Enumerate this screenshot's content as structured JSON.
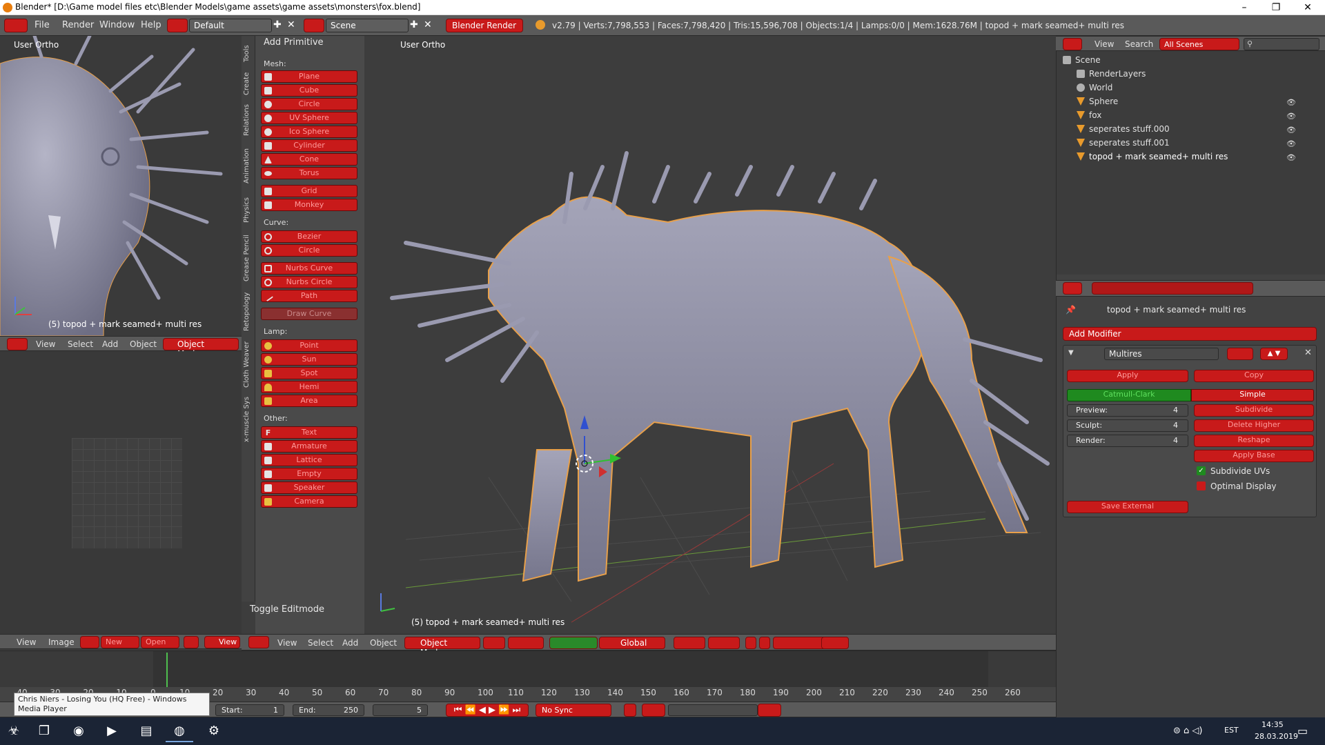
{
  "window": {
    "title": "Blender* [D:\\Game model files etc\\Blender Models\\game assets\\game assets\\monsters\\fox.blend]",
    "minimize": "–",
    "maximize": "❐",
    "close": "✕"
  },
  "menu": {
    "items": [
      "File",
      "Render",
      "Window",
      "Help"
    ],
    "layout": "Default",
    "scene": "Scene",
    "engine": "Blender Render",
    "stats": "v2.79 | Verts:7,798,553 | Faces:7,798,420 | Tris:15,596,708 | Objects:1/4 | Lamps:0/0 | Mem:1628.76M | topod + mark seamed+ multi res"
  },
  "left_vp": {
    "label": "User Ortho",
    "object": "(5) topod + mark seamed+ multi res",
    "header": [
      "View",
      "Select",
      "Add",
      "Object"
    ],
    "mode": "Object Mode"
  },
  "uv_header": {
    "items": [
      "View",
      "Image"
    ],
    "new": "New",
    "open": "Open",
    "view": "View"
  },
  "toolshelf": {
    "tabs": [
      "Tools",
      "Create",
      "Relations",
      "Animation",
      "Physics",
      "Grease Pencil",
      "Retopology",
      "Cloth Weaver",
      "x-muscle Sys"
    ],
    "panel_title": "Add Primitive",
    "mesh_label": "Mesh:",
    "mesh": [
      "Plane",
      "Cube",
      "Circle",
      "UV Sphere",
      "Ico Sphere",
      "Cylinder",
      "Cone",
      "Torus"
    ],
    "mesh2": [
      "Grid",
      "Monkey"
    ],
    "curve_label": "Curve:",
    "curve": [
      "Bezier",
      "Circle"
    ],
    "curve2": [
      "Nurbs Curve",
      "Nurbs Circle",
      "Path"
    ],
    "draw_curve": "Draw Curve",
    "lamp_label": "Lamp:",
    "lamp": [
      "Point",
      "Sun",
      "Spot",
      "Hemi",
      "Area"
    ],
    "other_label": "Other:",
    "other": [
      "Text",
      "Armature",
      "Lattice",
      "Empty",
      "Speaker",
      "Camera"
    ],
    "toggle": "Toggle Editmode"
  },
  "main_vp": {
    "label": "User Ortho",
    "object": "(5) topod + mark seamed+ multi res",
    "header": [
      "View",
      "Select",
      "Add",
      "Object"
    ],
    "mode": "Object Mode",
    "orientation": "Global"
  },
  "timeline": {
    "ticks": [
      "-40",
      "-30",
      "-20",
      "-10",
      "0",
      "10",
      "20",
      "30",
      "40",
      "50",
      "60",
      "70",
      "80",
      "90",
      "100",
      "110",
      "120",
      "130",
      "140",
      "150",
      "160",
      "170",
      "180",
      "190",
      "200",
      "210",
      "220",
      "230",
      "240",
      "250",
      "260"
    ],
    "start_label": "Start:",
    "start": "1",
    "end_label": "End:",
    "end": "250",
    "current": "5",
    "sync": "No Sync"
  },
  "tooltip": "Chris Niers - Losing You (HQ Free) - Windows Media Player",
  "outliner": {
    "view": "View",
    "search": "Search",
    "filter": "All Scenes",
    "items": [
      "Scene",
      "RenderLayers",
      "World",
      "Sphere",
      "fox",
      "seperates stuff.000",
      "seperates stuff.001",
      "topod + mark seamed+ multi res"
    ]
  },
  "properties": {
    "context": "topod + mark seamed+ multi res",
    "add_modifier": "Add Modifier",
    "modifier_name": "Multires",
    "apply": "Apply",
    "copy": "Copy",
    "catmull": "Catmull-Clark",
    "simple": "Simple",
    "preview_label": "Preview:",
    "preview": "4",
    "sculpt_label": "Sculpt:",
    "sculpt": "4",
    "render_label": "Render:",
    "render": "4",
    "subdivide": "Subdivide",
    "delete_higher": "Delete Higher",
    "reshape": "Reshape",
    "apply_base": "Apply Base",
    "subdivide_uvs": "Subdivide UVs",
    "optimal_display": "Optimal Display",
    "save_external": "Save External"
  },
  "taskbar": {
    "lang": "EST",
    "time": "14:35",
    "date": "28.03.2019"
  },
  "colors": {
    "accent_red": "#c81a1a",
    "outline_orange": "#e8a04a",
    "model": "#8a8aa2"
  }
}
